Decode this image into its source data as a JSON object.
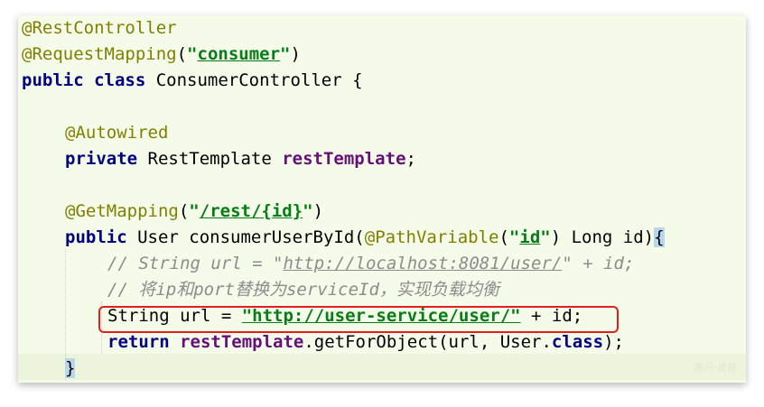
{
  "code": {
    "l1_annotation": "@RestController",
    "l2_annotation": "@RequestMapping",
    "l2_open": "(",
    "l2_quote_open": "\"",
    "l2_value": "consumer",
    "l2_quote_close": "\"",
    "l2_close": ")",
    "l3_public": "public",
    "l3_class": "class",
    "l3_name": " ConsumerController {",
    "l5_annotation": "@Autowired",
    "l6_private": "private",
    "l6_type": " RestTemplate ",
    "l6_field": "restTemplate",
    "l6_semi": ";",
    "l8_annotation": "@GetMapping",
    "l8_open": "(",
    "l8_quote_open": "\"",
    "l8_path": "/rest/",
    "l8_var": "{id}",
    "l8_quote_close": "\"",
    "l8_close": ")",
    "l9_public": "public",
    "l9_sig": " User consumerUserById(",
    "l9_annotation": "@PathVariable",
    "l9_open": "(",
    "l9_quote_open": "\"",
    "l9_id": "id",
    "l9_quote_close": "\"",
    "l9_rest": ") Long id)",
    "l9_brace": "{",
    "l10_prefix": "// String url = \"",
    "l10_link": "http://localhost:8081/user/",
    "l10_suffix": "\" + id;",
    "l11_comment": "// 将ip和port替换为serviceId，实现负载均衡",
    "l12_decl": "String url = ",
    "l12_string": "\"http://user-service/user/\"",
    "l12_tail": " + id;",
    "l13_return": "return",
    "l13_field": " restTemplate",
    "l13_call": ".getForObject(url, User.",
    "l13_class": "class",
    "l13_end": ");",
    "l14_brace": "}"
  },
  "watermark": "黑马·虎哥"
}
